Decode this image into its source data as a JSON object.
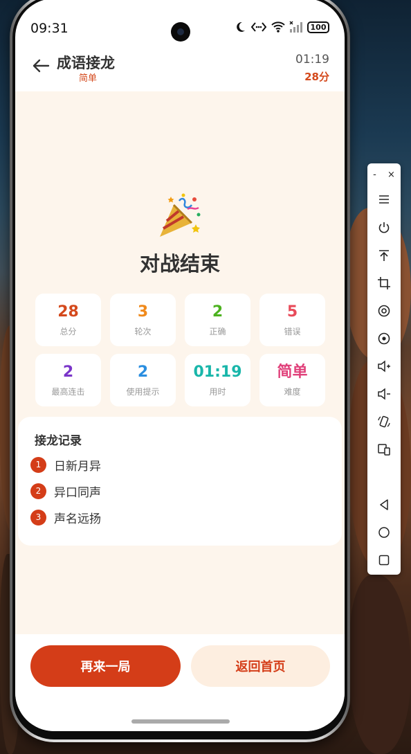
{
  "status_bar": {
    "time": "09:31",
    "battery": "100"
  },
  "header": {
    "title": "成语接龙",
    "difficulty": "简单",
    "timer": "01:19",
    "score": "28分"
  },
  "result": {
    "emoji": "🎉",
    "title": "对战结束"
  },
  "stats": [
    {
      "value": "28",
      "label": "总分",
      "color": "#d4491c"
    },
    {
      "value": "3",
      "label": "轮次",
      "color": "#f08a1c"
    },
    {
      "value": "2",
      "label": "正确",
      "color": "#4cb21f"
    },
    {
      "value": "5",
      "label": "错误",
      "color": "#e84b5a"
    },
    {
      "value": "2",
      "label": "最高连击",
      "color": "#7a35c9"
    },
    {
      "value": "2",
      "label": "使用提示",
      "color": "#2a8ee0"
    },
    {
      "value": "01:19",
      "label": "用时",
      "color": "#19b6aa"
    },
    {
      "value": "简单",
      "label": "难度",
      "color": "#e0407a"
    }
  ],
  "records": {
    "title": "接龙记录",
    "items": [
      {
        "index": "1",
        "idiom": "日新月异"
      },
      {
        "index": "2",
        "idiom": "异口同声"
      },
      {
        "index": "3",
        "idiom": "声名远扬"
      }
    ]
  },
  "actions": {
    "play_again": "再来一局",
    "back_home": "返回首页"
  },
  "side_toolbar": {
    "top_minimize": "-",
    "top_close": "×",
    "icons": [
      "menu-icon",
      "power-icon",
      "pin-top-icon",
      "crop-icon",
      "screenshot-icon",
      "screen-record-icon",
      "volume-up-icon",
      "volume-down-icon",
      "rotate-icon",
      "device-switch-icon",
      "nav-back-icon",
      "nav-home-icon",
      "nav-recents-icon"
    ]
  }
}
